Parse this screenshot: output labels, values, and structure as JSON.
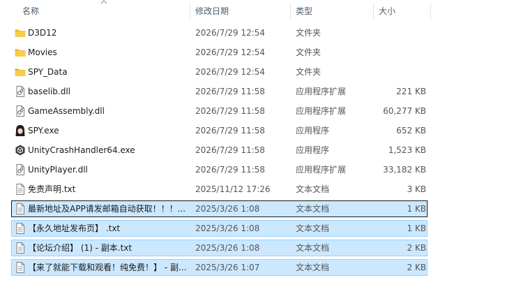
{
  "columns": {
    "name": "名称",
    "date": "修改日期",
    "type": "类型",
    "size": "大小"
  },
  "files": [
    {
      "name": "D3D12",
      "date": "2026/7/29 12:54",
      "type": "文件夹",
      "size": "",
      "icon": "folder-icon",
      "selected": false
    },
    {
      "name": "Movies",
      "date": "2026/7/29 12:54",
      "type": "文件夹",
      "size": "",
      "icon": "folder-icon",
      "selected": false
    },
    {
      "name": "SPY_Data",
      "date": "2026/7/29 12:54",
      "type": "文件夹",
      "size": "",
      "icon": "folder-icon",
      "selected": false
    },
    {
      "name": "baselib.dll",
      "date": "2026/7/29 11:58",
      "type": "应用程序扩展",
      "size": "221 KB",
      "icon": "dll-icon",
      "selected": false
    },
    {
      "name": "GameAssembly.dll",
      "date": "2026/7/29 11:58",
      "type": "应用程序扩展",
      "size": "60,277 KB",
      "icon": "dll-icon",
      "selected": false
    },
    {
      "name": "SPY.exe",
      "date": "2026/7/29 11:58",
      "type": "应用程序",
      "size": "652 KB",
      "icon": "app-avatar-icon",
      "selected": false
    },
    {
      "name": "UnityCrashHandler64.exe",
      "date": "2026/7/29 11:58",
      "type": "应用程序",
      "size": "1,523 KB",
      "icon": "unity-icon",
      "selected": false
    },
    {
      "name": "UnityPlayer.dll",
      "date": "2026/7/29 11:58",
      "type": "应用程序扩展",
      "size": "33,182 KB",
      "icon": "dll-icon",
      "selected": false
    },
    {
      "name": "免责声明.txt",
      "date": "2025/11/12 17:26",
      "type": "文本文档",
      "size": "3 KB",
      "icon": "text-file-icon",
      "selected": false
    },
    {
      "name": "最新地址及APP请发邮箱自动获取！！！...",
      "date": "2025/3/26 1:08",
      "type": "文本文档",
      "size": "1 KB",
      "icon": "text-file-icon",
      "selected": true,
      "focused": true
    },
    {
      "name": "【永久地址发布页】 .txt",
      "date": "2025/3/26 1:08",
      "type": "文本文档",
      "size": "1 KB",
      "icon": "text-file-icon",
      "selected": true
    },
    {
      "name": "【论坛介绍】 (1) - 副本.txt",
      "date": "2025/3/26 1:08",
      "type": "文本文档",
      "size": "2 KB",
      "icon": "text-file-icon",
      "selected": true
    },
    {
      "name": "【来了就能下载和观看！纯免费！】 - 副...",
      "date": "2025/3/26 1:07",
      "type": "文本文档",
      "size": "2 KB",
      "icon": "text-file-icon",
      "selected": true
    }
  ],
  "colors": {
    "selection_bg": "#cce8ff",
    "selection_border": "#99d1ff",
    "folder": "#f4c242"
  }
}
